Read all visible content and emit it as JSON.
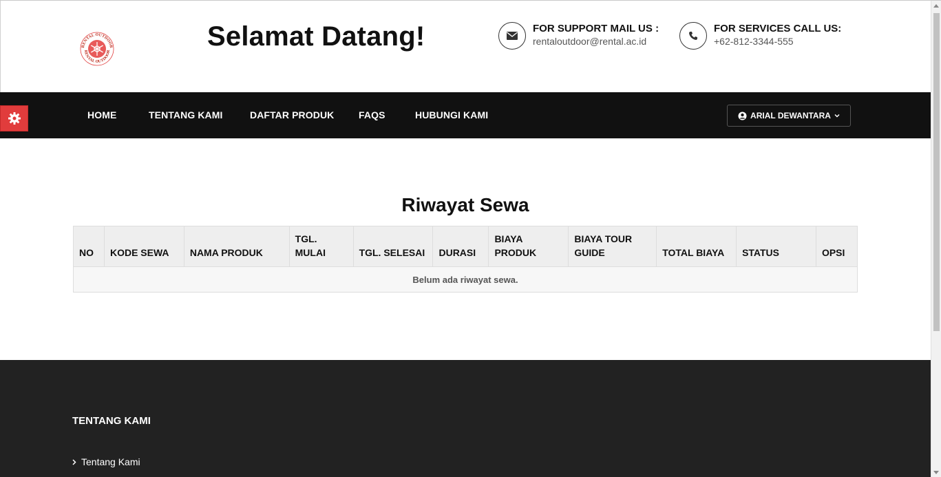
{
  "header": {
    "logo_text_top": "RENTAL OUTDOOR",
    "logo_text_bottom": "RENTAL OUTDOOR",
    "welcome": "Selamat Datang!",
    "support": {
      "title": "FOR SUPPORT MAIL US :",
      "value": "rentaloutdoor@rental.ac.id",
      "icon": "envelope-icon"
    },
    "services": {
      "title": "FOR SERVICES CALL US:",
      "value": "+62-812-3344-555",
      "icon": "phone-icon"
    }
  },
  "nav": {
    "items": [
      {
        "label": "HOME"
      },
      {
        "label": "TENTANG KAMI"
      },
      {
        "label": "DAFTAR PRODUK"
      },
      {
        "label": "FAQS"
      },
      {
        "label": "HUBUNGI KAMI"
      }
    ],
    "user_label": "ARIAL DEWANTARA",
    "settings_icon": "gear-icon"
  },
  "main": {
    "title": "Riwayat Sewa",
    "columns": [
      "NO",
      "KODE SEWA",
      "NAMA PRODUK",
      "TGL. MULAI",
      "TGL. SELESAI",
      "DURASI",
      "BIAYA PRODUK",
      "BIAYA TOUR GUIDE",
      "TOTAL BIAYA",
      "STATUS",
      "OPSI"
    ],
    "empty_message": "Belum ada riwayat sewa."
  },
  "footer": {
    "heading": "TENTANG KAMI",
    "links": [
      {
        "label": "Tentang Kami"
      }
    ]
  },
  "colors": {
    "accent": "#e13c3c",
    "nav_bg": "#111111",
    "footer_bg": "#222222"
  }
}
